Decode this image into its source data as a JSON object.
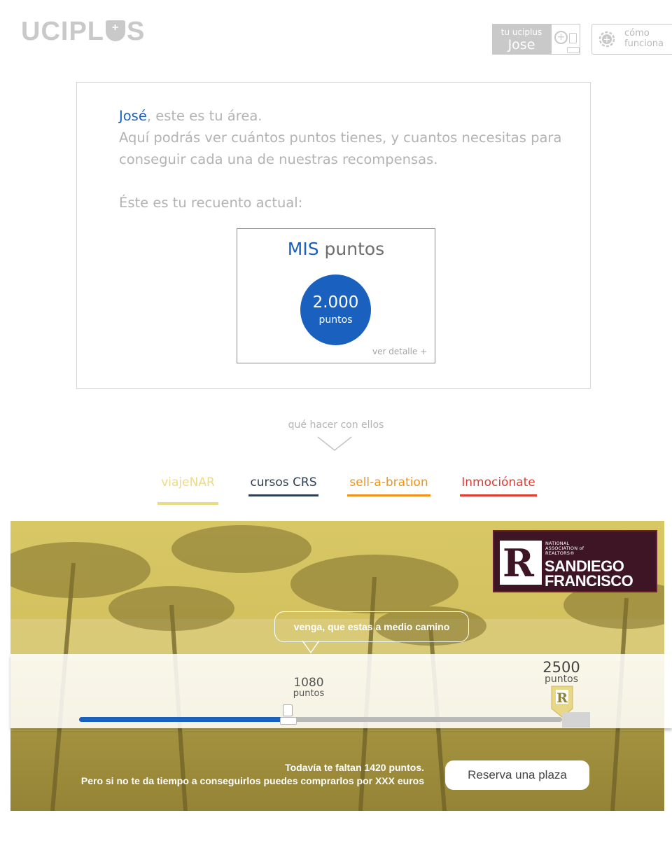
{
  "header": {
    "logo_text": "UCIPLUS",
    "user_greeting_label": "tu uciplus",
    "user_name": "Jose",
    "how_it_works_label_1": "cómo",
    "how_it_works_label_2": "funciona"
  },
  "intro": {
    "name": "José",
    "line1_rest": ", este es tu área.",
    "line2": "Aquí podrás ver cuántos puntos tienes, y cuantos necesitas para conseguir cada una de nuestras recompensas.",
    "count_label": "Éste es tu recuento actual:"
  },
  "points_card": {
    "title_prefix": "MIS",
    "title_suffix": " puntos",
    "value": "2.000",
    "unit": "puntos",
    "detail_link": "ver detalle  +"
  },
  "what_next_label": "qué hacer con ellos",
  "tabs": [
    {
      "label": "viajeNAR",
      "color": "#eed985",
      "active": true
    },
    {
      "label": "cursos CRS",
      "color": "#2e4055",
      "active": false
    },
    {
      "label": "sell-a-bration",
      "color": "#f19419",
      "active": false
    },
    {
      "label": "Inmociónate",
      "color": "#e23b2f",
      "active": false
    }
  ],
  "banner": {
    "logo_assoc_line1": "NATIONAL",
    "logo_assoc_line2": "ASSOCIATION of",
    "logo_assoc_line3": "REALTORS®",
    "logo_city_1": "SANDIEGO",
    "logo_city_2": "FRANCISCO",
    "bubble_text": "venga, que estas a medio camino",
    "current_points": "1080",
    "current_unit": "puntos",
    "goal_points": "2500",
    "goal_unit": "puntos",
    "progress_fraction": 0.432,
    "remaining_line1": "Todavía te faltan 1420 puntos.",
    "remaining_line2": "Pero si no te da tiempo a conseguirlos puedes comprarlos por XXX euros",
    "reserve_button": "Reserva una plaza"
  },
  "colors": {
    "brand_blue": "#1960bf",
    "banner_tint": "#d0bd5c",
    "grey_text": "#b3b3b3"
  }
}
